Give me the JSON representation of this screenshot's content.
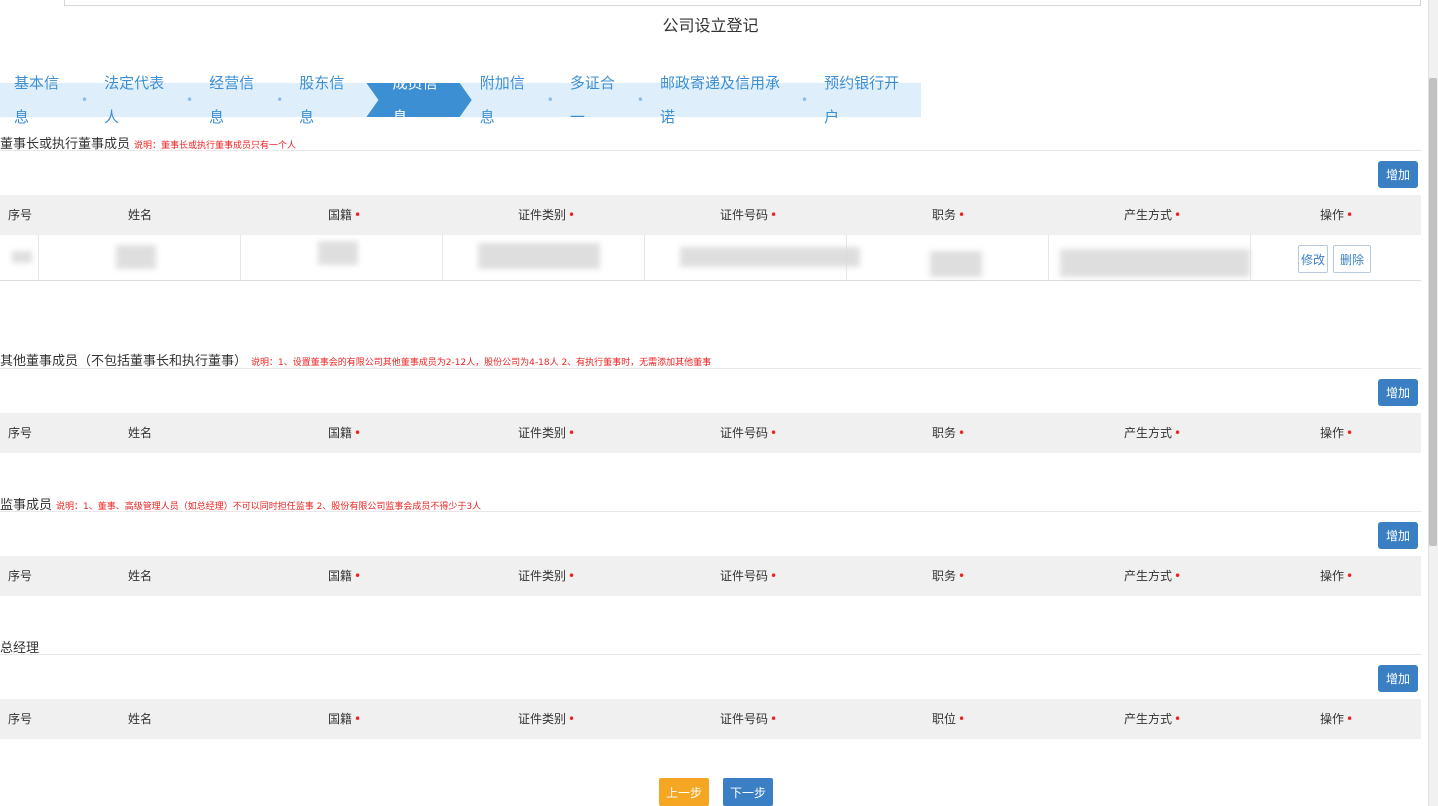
{
  "page": {
    "title": "公司设立登记"
  },
  "steps": [
    {
      "label": "基本信息",
      "active": false
    },
    {
      "label": "法定代表人",
      "active": false
    },
    {
      "label": "经营信息",
      "active": false
    },
    {
      "label": "股东信息",
      "active": false
    },
    {
      "label": "成员信息",
      "active": true
    },
    {
      "label": "附加信息",
      "active": false
    },
    {
      "label": "多证合一",
      "active": false
    },
    {
      "label": "邮政寄递及信用承诺",
      "active": false
    },
    {
      "label": "预约银行开户",
      "active": false
    }
  ],
  "columns": {
    "seq": "序号",
    "name": "姓名",
    "nationality": "国籍",
    "id_type": "证件类别",
    "id_number": "证件号码",
    "position": "职务",
    "position_alt": "职位",
    "method": "产生方式",
    "action": "操作",
    "required_mark": "•"
  },
  "sections": {
    "chairman": {
      "title": "董事长或执行董事成员",
      "note": "说明：董事长或执行董事成员只有一个人",
      "add_label": "增加",
      "row_actions": {
        "edit": "修改",
        "delete": "删除"
      }
    },
    "directors": {
      "title": "其他董事成员（不包括董事长和执行董事）",
      "note": "说明：1、设置董事会的有限公司其他董事成员为2-12人，股份公司为4-18人   2、有执行董事时，无需添加其他董事",
      "add_label": "增加"
    },
    "supervisors": {
      "title": "监事成员",
      "note": "说明：1、董事、高级管理人员（如总经理）不可以同时担任监事    2、股份有限公司监事会成员不得少于3人",
      "add_label": "增加"
    },
    "manager": {
      "title": "总经理",
      "note": "",
      "add_label": "增加"
    }
  },
  "footer": {
    "prev_label": "上一步",
    "next_label": "下一步"
  },
  "colors": {
    "accent": "#3a7fc4",
    "step_active": "#3d8fd4",
    "step_bg": "#dfeefb",
    "prev": "#f5a623",
    "required": "#e22222"
  }
}
